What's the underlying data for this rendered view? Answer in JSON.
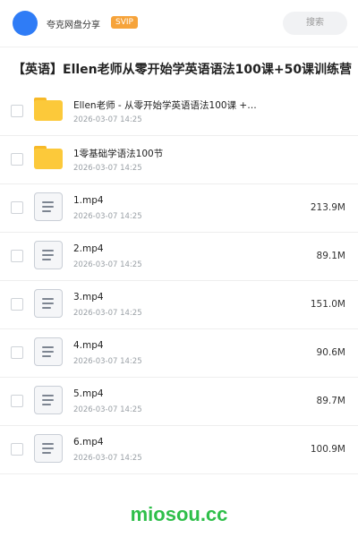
{
  "header": {
    "app_name": "夸克网盘分享",
    "badge": "SVIP",
    "search_label": "搜索"
  },
  "title": "【英语】Ellen老师从零开始学英语语法100课+50课训练营",
  "rows": [
    {
      "kind": "folder",
      "name": "Ellen老师 - 从零开始学英语语法100课 +…",
      "date": "2026-03-07 14:25",
      "size": ""
    },
    {
      "kind": "folder",
      "name": "1零基础学语法100节",
      "date": "2026-03-07 14:25",
      "size": ""
    },
    {
      "kind": "file",
      "name": "1.mp4",
      "date": "2026-03-07 14:25",
      "size": "213.9M"
    },
    {
      "kind": "file",
      "name": "2.mp4",
      "date": "2026-03-07 14:25",
      "size": "89.1M"
    },
    {
      "kind": "file",
      "name": "3.mp4",
      "date": "2026-03-07 14:25",
      "size": "151.0M"
    },
    {
      "kind": "file",
      "name": "4.mp4",
      "date": "2026-03-07 14:25",
      "size": "90.6M"
    },
    {
      "kind": "file",
      "name": "5.mp4",
      "date": "2026-03-07 14:25",
      "size": "89.7M"
    },
    {
      "kind": "file",
      "name": "6.mp4",
      "date": "2026-03-07 14:25",
      "size": "100.9M"
    }
  ],
  "watermark": "miosou.cc",
  "colors": {
    "accent": "#2f7cf6",
    "svip": "#f6a33a",
    "folder": "#fcc93a",
    "watermark": "#2fbf4a"
  }
}
